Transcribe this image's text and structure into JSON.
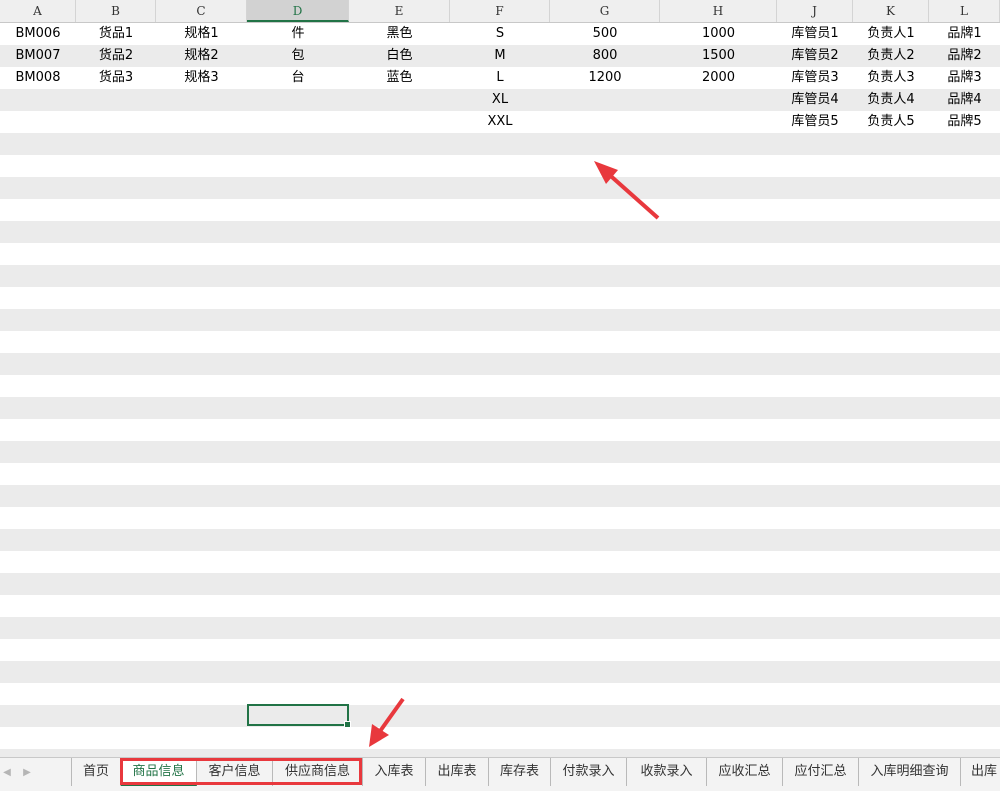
{
  "columns": [
    "A",
    "B",
    "C",
    "D",
    "E",
    "F",
    "G",
    "H",
    "J",
    "K",
    "L"
  ],
  "active_column": "D",
  "rows": [
    [
      "BM006",
      "货品1",
      "规格1",
      "件",
      "黑色",
      "S",
      "500",
      "1000",
      "库管员1",
      "负责人1",
      "品牌1"
    ],
    [
      "BM007",
      "货品2",
      "规格2",
      "包",
      "白色",
      "M",
      "800",
      "1500",
      "库管员2",
      "负责人2",
      "品牌2"
    ],
    [
      "BM008",
      "货品3",
      "规格3",
      "台",
      "蓝色",
      "L",
      "1200",
      "2000",
      "库管员3",
      "负责人3",
      "品牌3"
    ],
    [
      "",
      "",
      "",
      "",
      "",
      "XL",
      "",
      "",
      "库管员4",
      "负责人4",
      "品牌4"
    ],
    [
      "",
      "",
      "",
      "",
      "",
      "XXL",
      "",
      "",
      "库管员5",
      "负责人5",
      "品牌5"
    ]
  ],
  "sheet_tabs": [
    "首页",
    "商品信息",
    "客户信息",
    "供应商信息",
    "入库表",
    "出库表",
    "库存表",
    "付款录入",
    "收款录入",
    "应收汇总",
    "应付汇总",
    "入库明细查询",
    "出库"
  ],
  "active_tab": "商品信息",
  "nav_icons": [
    "scroll-left-icon",
    "scroll-right-icon"
  ],
  "colors": {
    "accent": "#217346",
    "annotation": "#e8383d",
    "stripe": "#ebebeb"
  }
}
